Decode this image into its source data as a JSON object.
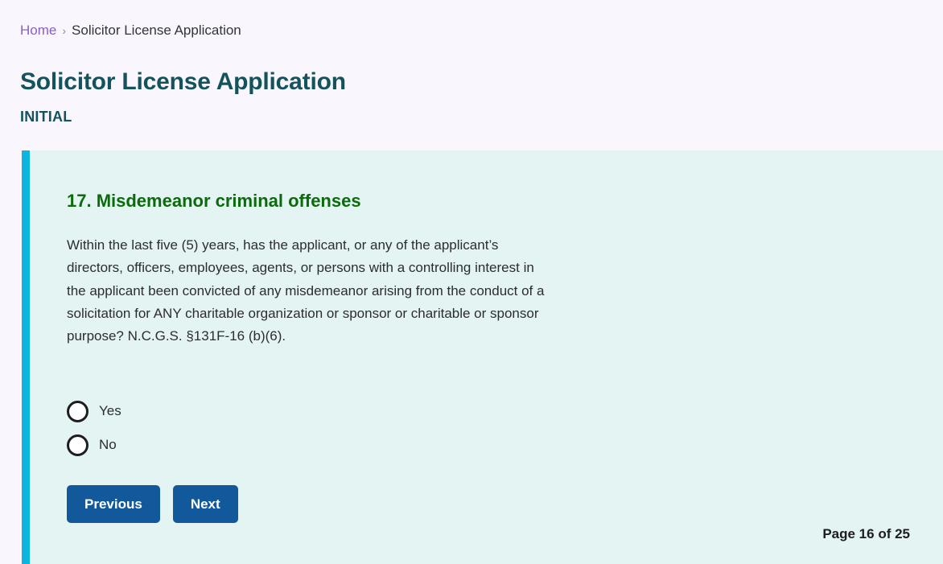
{
  "breadcrumb": {
    "home_label": "Home",
    "separator": "›",
    "current_label": "Solicitor License Application"
  },
  "header": {
    "title": "Solicitor License Application",
    "subtitle": "INITIAL"
  },
  "question": {
    "heading": "17. Misdemeanor criminal offenses",
    "body": "Within the last five (5) years, has the applicant, or any of the applicant’s directors, officers, employees, agents, or persons with a controlling interest in the applicant been convicted of any misdemeanor arising from the conduct of a solicitation for ANY charitable organization or sponsor or charitable or sponsor purpose? N.C.G.S. §131F-16 (b)(6).",
    "options": [
      {
        "label": "Yes",
        "selected": false
      },
      {
        "label": "No",
        "selected": false
      }
    ]
  },
  "actions": {
    "previous_label": "Previous",
    "next_label": "Next"
  },
  "footer": {
    "page_counter": "Page 16 of 25"
  },
  "colors": {
    "page_background": "#f9f7fd",
    "panel_background": "#e4f4f3",
    "accent_bar": "#0bb5df",
    "title_teal": "#14535c",
    "heading_green": "#0b6b0b",
    "button_blue": "#12599c",
    "link_purple": "#8b5fbf"
  }
}
